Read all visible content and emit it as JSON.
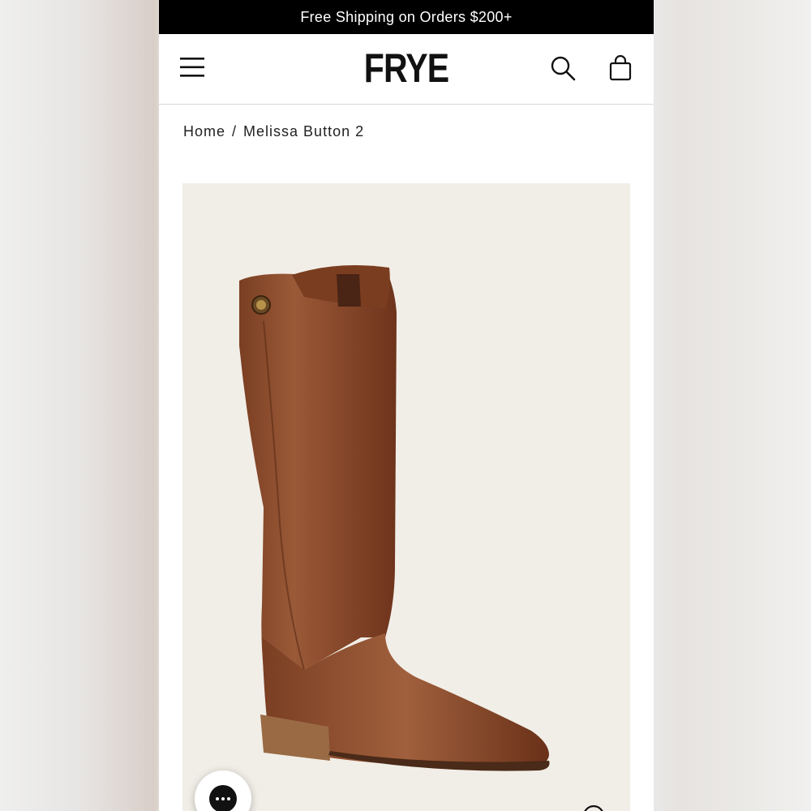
{
  "promo": {
    "text": "Free Shipping on Orders $200+"
  },
  "header": {
    "logo_text": "FRYE",
    "menu_icon": "hamburger-menu-icon",
    "search_icon": "search-icon",
    "bag_icon": "shopping-bag-icon"
  },
  "breadcrumb": {
    "items": [
      {
        "label": "Home"
      },
      {
        "label": "Melissa Button 2"
      }
    ],
    "separator": "/"
  },
  "product": {
    "image_alt": "Melissa Button 2",
    "image_background": "#f1eee7",
    "leather_color": "#8a4a2c"
  },
  "chat": {
    "icon": "chat-ellipsis-icon"
  },
  "zoom": {
    "icon": "zoom-icon"
  },
  "colors": {
    "promo_bg": "#000000",
    "promo_text": "#ffffff",
    "text": "#222222"
  }
}
